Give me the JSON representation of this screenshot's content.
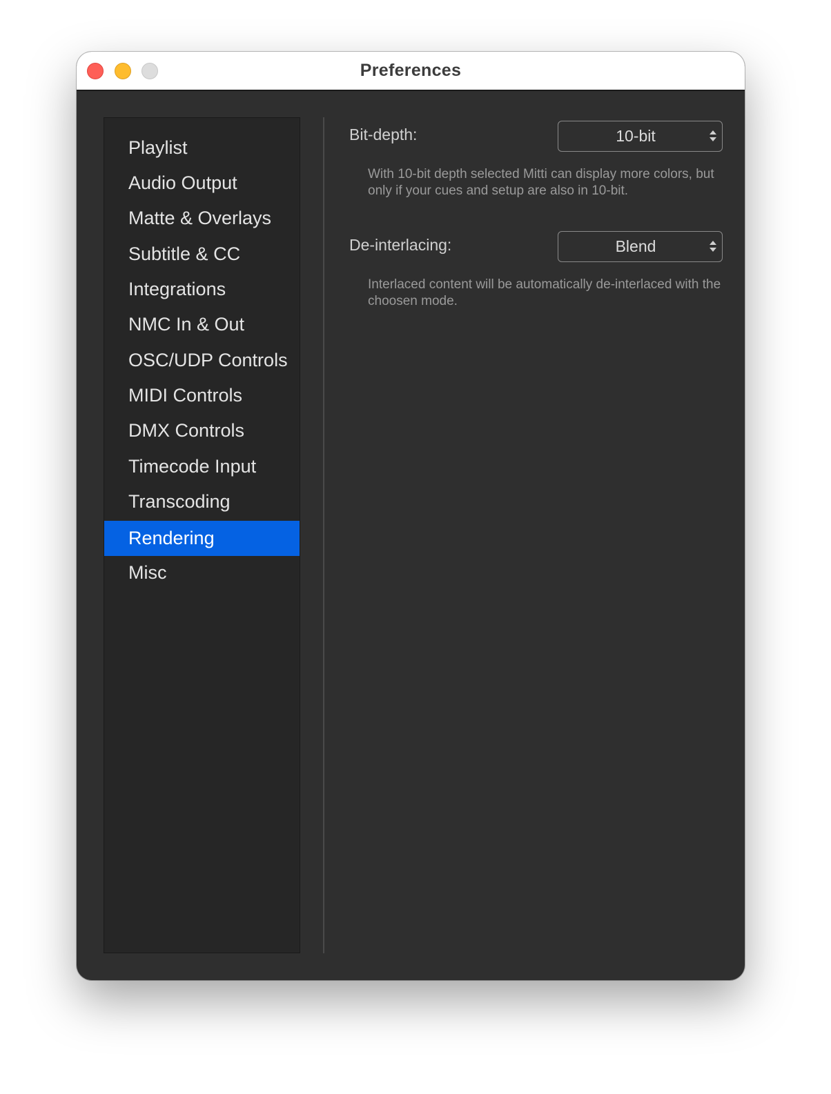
{
  "window": {
    "title": "Preferences"
  },
  "sidebar": {
    "items": [
      {
        "label": "Playlist"
      },
      {
        "label": "Audio Output"
      },
      {
        "label": "Matte & Overlays"
      },
      {
        "label": "Subtitle & CC"
      },
      {
        "label": "Integrations"
      },
      {
        "label": "NMC In & Out"
      },
      {
        "label": "OSC/UDP Controls"
      },
      {
        "label": "MIDI Controls"
      },
      {
        "label": "DMX Controls"
      },
      {
        "label": "Timecode Input"
      },
      {
        "label": "Transcoding"
      },
      {
        "label": "Rendering",
        "selected": true
      },
      {
        "label": "Misc"
      }
    ],
    "selected_color": "#0562e3"
  },
  "rendering": {
    "bit_depth": {
      "label": "Bit-depth:",
      "value": "10-bit",
      "help": "With 10-bit depth selected Mitti can display more colors, but only if your cues and setup are also in 10-bit."
    },
    "deinterlacing": {
      "label": "De-interlacing:",
      "value": "Blend",
      "help": "Interlaced content will be automatically de-interlaced with the choosen mode."
    }
  },
  "icons": {
    "close": "close-traffic-light-icon",
    "minimize": "minimize-traffic-light-icon",
    "zoom": "zoom-traffic-light-icon",
    "popup": "up-down-chevron-icon"
  }
}
